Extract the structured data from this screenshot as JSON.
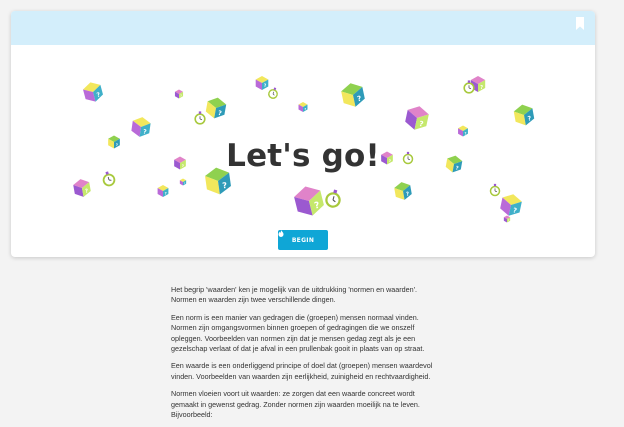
{
  "header": {
    "bookmark_icon": "bookmark-icon",
    "accent_color": "#d3eefb"
  },
  "hero": {
    "title": "Let's go!",
    "begin_label": "BEGIN",
    "begin_icon": "flame-icon",
    "button_color": "#0fa6d6",
    "decorations": [
      "question-cube-icon",
      "stopwatch-icon"
    ]
  },
  "content": {
    "paragraphs": [
      "Het begrip 'waarden' ken je mogelijk van de uitdrukking 'normen en waarden'. Normen en waarden zijn twee verschillende dingen.",
      "Een norm is een manier van gedragen die (groepen) mensen normaal vinden. Normen zijn omgangsvormen binnen groepen of gedragingen die we onszelf opleggen. Voorbeelden van normen zijn dat je mensen gedag zegt als je een gezelschap verlaat of dat je afval in een prullenbak gooit in plaats van op straat.",
      "Een waarde is een onderliggend principe of doel dat (groepen) mensen waardevol vinden. Voorbeelden van waarden zijn eerlijkheid, zuinigheid en rechtvaardigheid.",
      "Normen vloeien voort uit waarden: ze zorgen dat een waarde concreet wordt gemaakt in gewenst gedrag. Zonder normen zijn waarden moeilijk na te leven. Bijvoorbeeld:"
    ]
  }
}
